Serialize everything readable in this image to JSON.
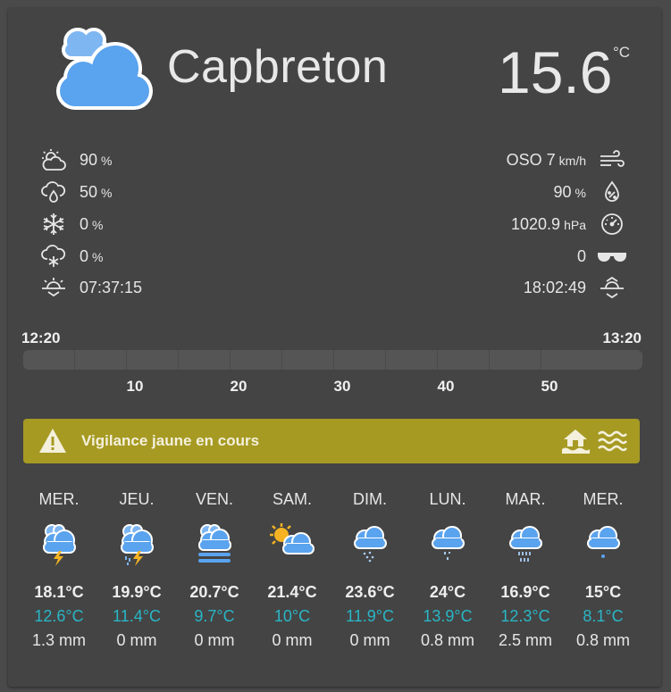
{
  "header": {
    "city": "Capbreton",
    "temperature": "15.6",
    "temperature_unit": "°C"
  },
  "details_left": [
    {
      "icon": "cloud-sun-icon",
      "value": "90",
      "unit": "%"
    },
    {
      "icon": "rain-probability-icon",
      "value": "50",
      "unit": "%"
    },
    {
      "icon": "frost-icon",
      "value": "0",
      "unit": "%"
    },
    {
      "icon": "snow-probability-icon",
      "value": "0",
      "unit": "%"
    },
    {
      "icon": "sunrise-icon",
      "value": "07:37:15",
      "unit": ""
    }
  ],
  "details_right": [
    {
      "icon": "wind-icon",
      "value": "OSO 7",
      "unit": "km/h"
    },
    {
      "icon": "humidity-icon",
      "value": "90",
      "unit": "%"
    },
    {
      "icon": "pressure-icon",
      "value": "1020.9",
      "unit": "hPa"
    },
    {
      "icon": "uv-sunglasses-icon",
      "value": "0",
      "unit": ""
    },
    {
      "icon": "sunset-icon",
      "value": "18:02:49",
      "unit": ""
    }
  ],
  "timeline": {
    "start": "12:20",
    "end": "13:20",
    "labels": [
      "10",
      "20",
      "30",
      "40",
      "50"
    ]
  },
  "vigilance": {
    "text": "Vigilance jaune en cours",
    "color": "#a69a23",
    "icons": [
      "flood-house-icon",
      "waves-icon"
    ]
  },
  "forecast": [
    {
      "day": "MER.",
      "icon": "storm-icon",
      "tmax": "18.1°C",
      "tmin": "12.6°C",
      "rain": "1.3 mm"
    },
    {
      "day": "JEU.",
      "icon": "storm-rain-icon",
      "tmax": "19.9°C",
      "tmin": "11.4°C",
      "rain": "0 mm"
    },
    {
      "day": "VEN.",
      "icon": "fog-icon",
      "tmax": "20.7°C",
      "tmin": "9.7°C",
      "rain": "0 mm"
    },
    {
      "day": "SAM.",
      "icon": "partly-sunny-icon",
      "tmax": "21.4°C",
      "tmin": "10°C",
      "rain": "0 mm"
    },
    {
      "day": "DIM.",
      "icon": "light-drizzle-icon",
      "tmax": "23.6°C",
      "tmin": "11.9°C",
      "rain": "0 mm"
    },
    {
      "day": "LUN.",
      "icon": "drizzle-icon",
      "tmax": "24°C",
      "tmin": "13.9°C",
      "rain": "0.8 mm"
    },
    {
      "day": "MAR.",
      "icon": "rain-icon",
      "tmax": "16.9°C",
      "tmin": "12.3°C",
      "rain": "2.5 mm"
    },
    {
      "day": "MER.",
      "icon": "light-rain-icon",
      "tmax": "15°C",
      "tmin": "8.1°C",
      "rain": "0.8 mm"
    }
  ],
  "colors": {
    "background": "#444444",
    "min_temp": "#29b6c6",
    "cloud_blue": "#5aa3ee",
    "vigilance_yellow": "#a69a23"
  }
}
